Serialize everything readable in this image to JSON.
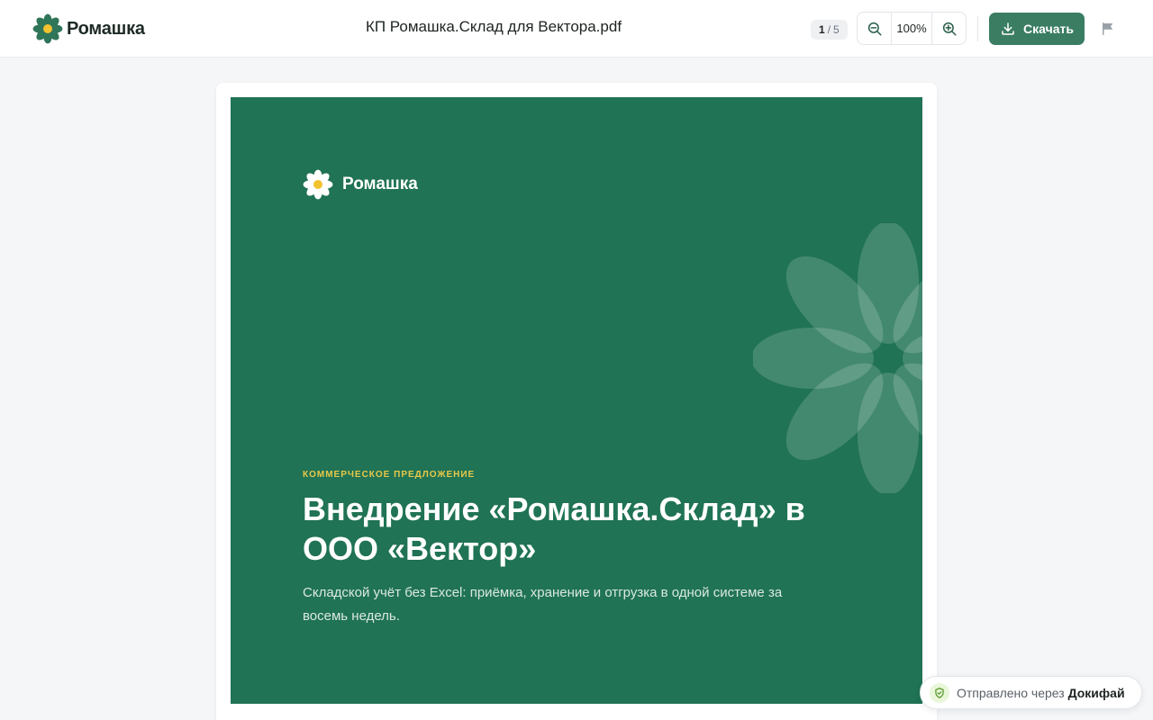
{
  "header": {
    "brand_name": "Ромашка",
    "document_title": "КП Ромашка.Склад для Вектора.pdf",
    "page_current": "1",
    "page_separator": "/",
    "page_total": "5",
    "zoom_level": "100%",
    "download_label": "Скачать"
  },
  "slide": {
    "brand_name": "Ромашка",
    "eyebrow": "КОММЕРЧЕСКОЕ ПРЕДЛОЖЕНИЕ",
    "title": "Внедрение «Ромашка.Склад» в ООО «Вектор»",
    "subtitle": "Складской учёт без Excel: приёмка, хранение и отгрузка в одной системе за восемь недель."
  },
  "footer_badge": {
    "prefix": "Отправлено через",
    "service": "Докифай"
  },
  "colors": {
    "brand_green": "#207354",
    "button_green": "#3a7d63",
    "accent_yellow": "#e8c84a",
    "flower_center": "#f2c230"
  },
  "icons": [
    "daisy-logo-icon",
    "zoom-out-icon",
    "zoom-in-icon",
    "download-icon",
    "flag-icon",
    "shield-check-icon"
  ]
}
